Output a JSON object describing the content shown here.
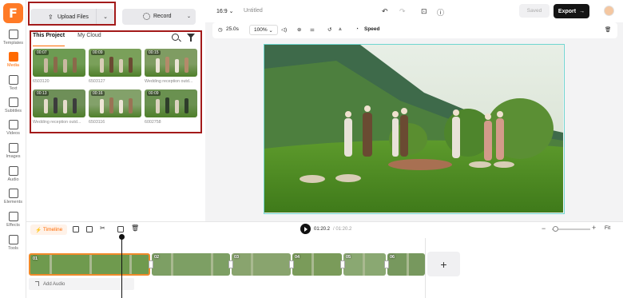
{
  "app": {
    "logo_letter": "F",
    "title": "Untitled",
    "aspect": "16:9"
  },
  "rail": {
    "items": [
      {
        "label": "Templates",
        "icon": "templates-icon"
      },
      {
        "label": "Media",
        "icon": "media-icon",
        "active": true
      },
      {
        "label": "Text",
        "icon": "text-icon"
      },
      {
        "label": "Subtitles",
        "icon": "subtitles-icon"
      },
      {
        "label": "Videos",
        "icon": "videos-icon"
      },
      {
        "label": "Images",
        "icon": "images-icon"
      },
      {
        "label": "Audio",
        "icon": "audio-icon"
      },
      {
        "label": "Elements",
        "icon": "elements-icon"
      },
      {
        "label": "Effects",
        "icon": "effects-icon"
      },
      {
        "label": "Tools",
        "icon": "tools-icon"
      }
    ]
  },
  "media": {
    "upload_label": "Upload Files",
    "record_label": "Record",
    "tabs": [
      "This Project",
      "My Cloud"
    ],
    "thumbs": [
      {
        "duration": "00:07",
        "name": "6503120"
      },
      {
        "duration": "00:09",
        "name": "6503127"
      },
      {
        "duration": "00:15",
        "name": "Wedding reception outd..."
      },
      {
        "duration": "00:13",
        "name": "Wedding reception outd..."
      },
      {
        "duration": "00:16",
        "name": "6503116"
      },
      {
        "duration": "00:09",
        "name": "6002758"
      }
    ]
  },
  "topbar": {
    "saved_label": "Saved",
    "export_label": "Export"
  },
  "toolbar": {
    "duration": "25.0s",
    "zoom": "100%",
    "speed_label": "Speed"
  },
  "timeline": {
    "label": "Timeline",
    "current_time": "01:20.2",
    "total_time": "/ 01:20.2",
    "fit_label": "Fit",
    "add_audio_label": "Add Audio",
    "clips": [
      "01",
      "02",
      "03",
      "04",
      "05",
      "06"
    ],
    "zoom_level": 0.1
  },
  "colors": {
    "accent": "#ff6a00",
    "selection": "#6fd6cf",
    "annotation_box": "#a31a1a"
  }
}
